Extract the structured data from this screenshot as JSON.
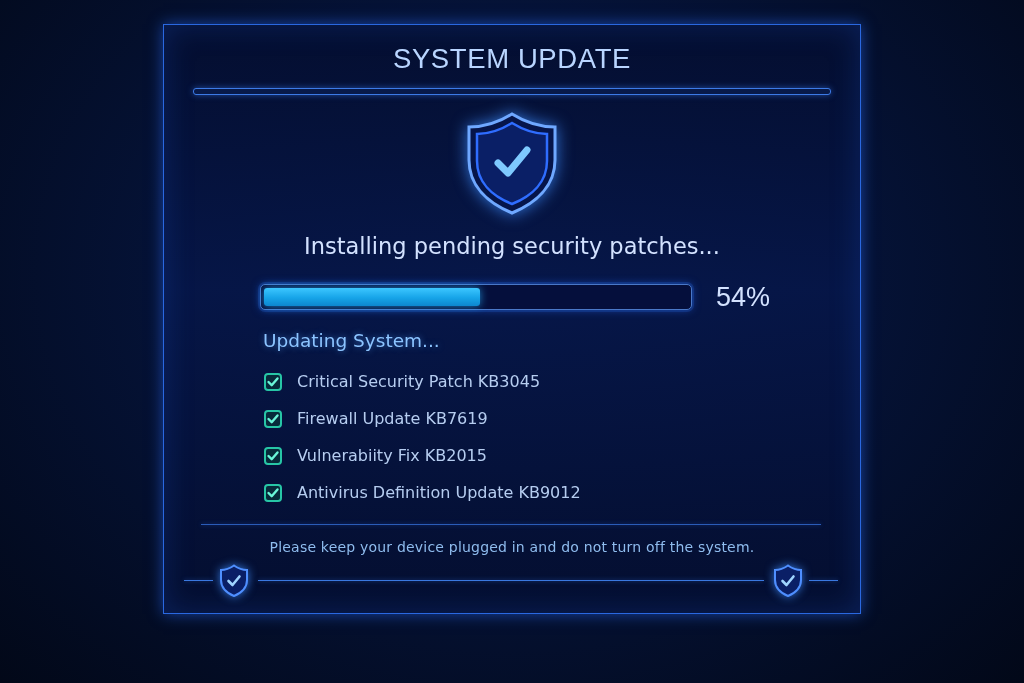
{
  "window": {
    "title": "SYSTEM UPDATE"
  },
  "status": {
    "message": "Installing pending security patches...",
    "progress": {
      "level": 0.51,
      "reading": "54%"
    }
  },
  "task_list": {
    "heading": "Updating System...",
    "items": [
      {
        "label": "Critical Security Patch KB3045",
        "checked": true
      },
      {
        "label": "Firewall Update KB7619",
        "checked": true
      },
      {
        "label": "Vulnerabiity Fix KB2015",
        "checked": true
      },
      {
        "label": "Antivirus Definition Update KB9012",
        "checked": true
      }
    ]
  },
  "notice": "Please keep your device plugged in and do not turn off the system."
}
